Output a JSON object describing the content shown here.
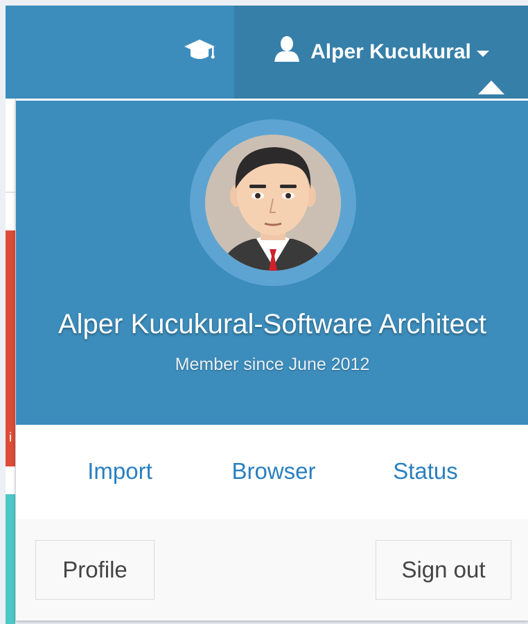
{
  "navbar": {
    "user_name": "Alper Kucukural",
    "icons": {
      "nav": "graduation-cap-icon",
      "user": "user-icon",
      "dropdown": "caret-down-icon"
    }
  },
  "dropdown": {
    "header": {
      "name_title": "Alper Kucukural-Software Architect",
      "member_since": "Member since June 2012"
    },
    "body_links": [
      "Import",
      "Browser",
      "Status"
    ],
    "footer": {
      "profile_label": "Profile",
      "signout_label": "Sign out"
    }
  },
  "background": {
    "partial_text": "i"
  },
  "colors": {
    "primary": "#3c8dbc",
    "primary_dark": "#367fa9",
    "link": "#2a7fbf",
    "danger": "#dd4b39",
    "teal": "#4fc7c7"
  }
}
